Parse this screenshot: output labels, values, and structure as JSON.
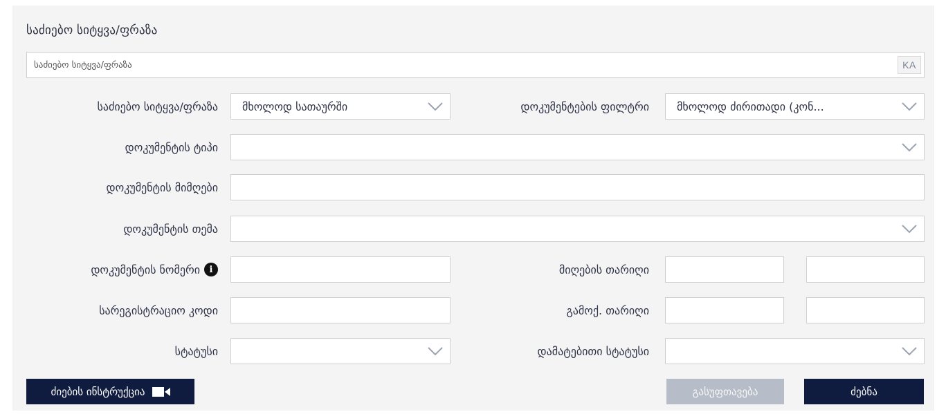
{
  "search": {
    "heading": "საძიებო სიტყვა/ფრაზა",
    "placeholder": "საძიებო სიტყვა/ფრაზა",
    "keyboard_toggle": "KA"
  },
  "fields": {
    "search_scope": {
      "label": "საძიებო სიტყვა/ფრაზა",
      "selected": "მხოლოდ სათაურში"
    },
    "document_filter": {
      "label": "დოკუმენტების ფილტრი",
      "selected": "მხოლოდ ძირითადი (კონ..."
    },
    "document_type": {
      "label": "დოკუმენტის ტიპი",
      "selected": ""
    },
    "document_issuer": {
      "label": "დოკუმენტის მიმღები",
      "value": ""
    },
    "document_topic": {
      "label": "დოკუმენტის თემა",
      "selected": ""
    },
    "document_number": {
      "label": "დოკუმენტის ნომერი",
      "value": ""
    },
    "adoption_date": {
      "label": "მიღების თარიღი",
      "from": "",
      "to": ""
    },
    "registration_code": {
      "label": "სარეგისტრაციო კოდი",
      "value": ""
    },
    "publication_date": {
      "label": "გამოქ. თარიღი",
      "from": "",
      "to": ""
    },
    "status": {
      "label": "სტატუსი",
      "selected": ""
    },
    "additional_status": {
      "label": "დამატებითი სტატუსი",
      "selected": ""
    }
  },
  "buttons": {
    "instruction": "ძიების ინსტრუქცია",
    "clear": "გასუფთავება",
    "search": "ძებნა"
  },
  "icons": {
    "info": "info-icon",
    "video": "video-camera-icon",
    "dropdown": "chevron-down-icon"
  },
  "colors": {
    "primary_button": "#0f1c3f",
    "secondary_button": "#b6bdc8",
    "panel_background": "#f4f4f4"
  }
}
